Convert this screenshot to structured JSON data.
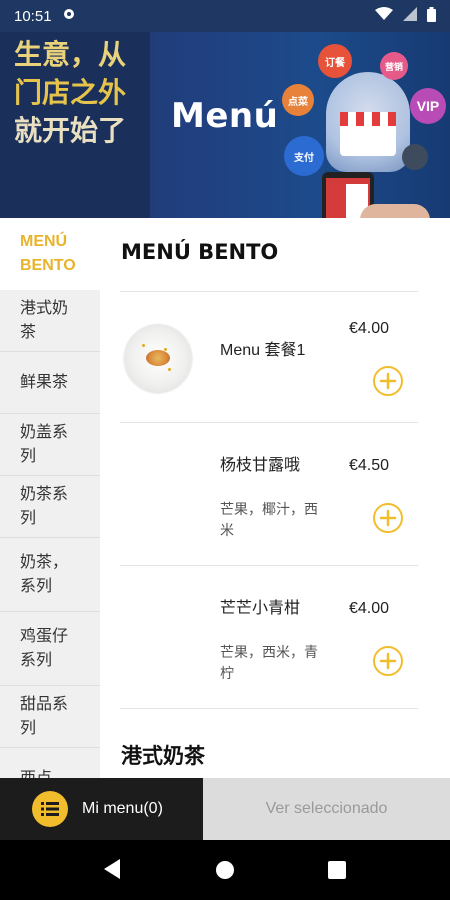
{
  "status_bar": {
    "time": "10:51",
    "gear_icon": "settings-gear-icon",
    "wifi_icon": "wifi-icon",
    "signal_icon": "signal-icon",
    "battery_icon": "battery-icon"
  },
  "banner": {
    "title": "Menú",
    "slogan_line1": "生意，从",
    "slogan_line2": "门店之外",
    "slogan_line3": "就开始了",
    "bubbles": [
      "订餐",
      "营销",
      "点菜",
      "VIP",
      "支付"
    ],
    "colors": {
      "background": "#1c3f7f",
      "gold": "#e6c44c"
    }
  },
  "sidebar": {
    "items": [
      {
        "label": "MENÚ BENTO",
        "active": true
      },
      {
        "label": "港式奶茶"
      },
      {
        "label": "鲜果茶"
      },
      {
        "label": "奶盖系列"
      },
      {
        "label": "奶茶系列"
      },
      {
        "label": "奶茶，系列"
      },
      {
        "label": "鸡蛋仔系列"
      },
      {
        "label": "甜品系列"
      },
      {
        "label": "西点"
      }
    ]
  },
  "main": {
    "section1_title": "MENÚ BENTO",
    "items": [
      {
        "name": "Menu 套餐1",
        "price": "€4.00",
        "has_image": true
      },
      {
        "name": "杨枝甘露哦",
        "description": "芒果，椰汁，西米",
        "price": "€4.50"
      },
      {
        "name": "芒芒小青柑",
        "description": "芒果，西米，青柠",
        "price": "€4.00"
      }
    ],
    "section2_title": "港式奶茶",
    "add_icon": "plus-circle-icon"
  },
  "bottom_bar": {
    "my_menu_label": "Mi menu(0)",
    "my_menu_icon": "list-icon",
    "view_selected_label": "Ver seleccionado"
  },
  "nav_bar": {
    "back_icon": "back-triangle-icon",
    "home_icon": "home-circle-icon",
    "recents_icon": "recents-square-icon"
  },
  "colors": {
    "accent": "#f2bd2c",
    "sidebar_bg": "#f0f0f0",
    "bottom_dark": "#1c1c1c",
    "bottom_light": "#dcdcdc"
  }
}
